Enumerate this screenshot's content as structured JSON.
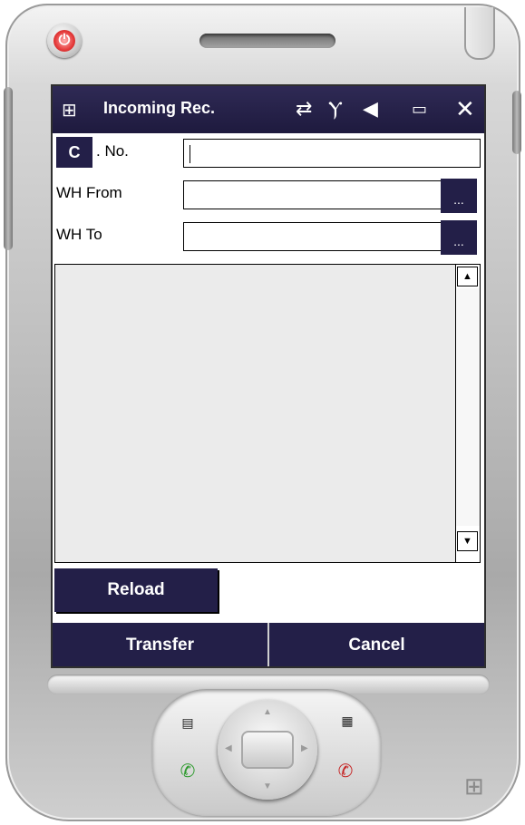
{
  "titlebar": {
    "title": "Incoming Rec.",
    "icons": [
      "windows-logo-icon",
      "connectivity-icon",
      "signal-off-icon",
      "volume-icon",
      "battery-icon",
      "close-icon"
    ]
  },
  "form": {
    "c_button_label": "C",
    "doc_no_label": ". No.",
    "doc_no_value": "",
    "wh_from_label": "WH From",
    "wh_from_value": "",
    "wh_to_label": "WH To",
    "wh_to_value": "",
    "lookup_button_label": "..."
  },
  "listbox": {
    "items": []
  },
  "buttons": {
    "reload": "Reload",
    "transfer": "Transfer",
    "cancel": "Cancel"
  },
  "colors": {
    "accent": "#231f48",
    "list_background": "#ebebeb"
  }
}
